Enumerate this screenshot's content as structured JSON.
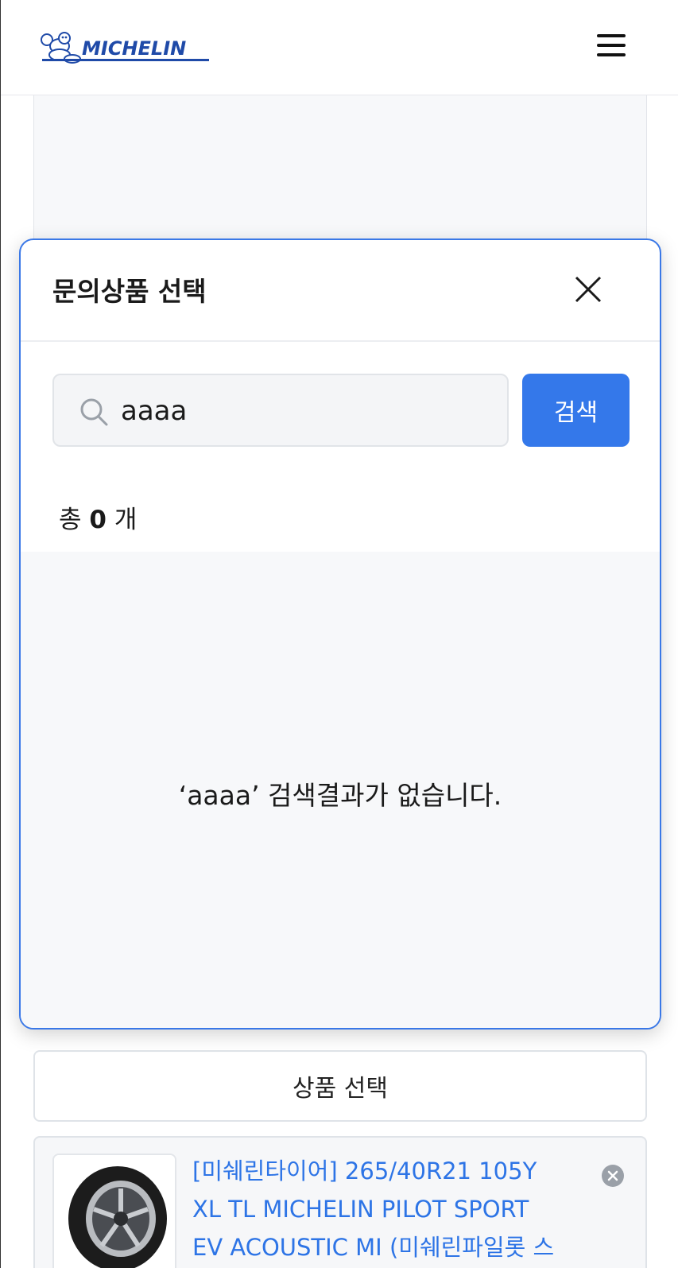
{
  "header": {
    "logo_text": "MICHELIN",
    "brand_color": "#1f4aa8",
    "menu_icon": "hamburger-icon"
  },
  "modal": {
    "title": "문의상품 선택",
    "close_icon": "close-icon",
    "search": {
      "icon": "search-icon",
      "value": "aaaa",
      "button_label": "검색"
    },
    "count": {
      "prefix": "총",
      "number": "0",
      "suffix": "개"
    },
    "empty_message": "‘aaaa’ 검색결과가 없습니다."
  },
  "form": {
    "select_product_label": "상품 선택",
    "selected_product": {
      "name": "[미쉐린타이어] 265/40R21 105Y XL TL MICHELIN PILOT SPORT EV ACOUSTIC MI (미쉐린파일롯 스포츠",
      "remove_icon": "remove-icon"
    }
  },
  "colors": {
    "accent": "#3478ea",
    "link": "#2d74e6"
  }
}
